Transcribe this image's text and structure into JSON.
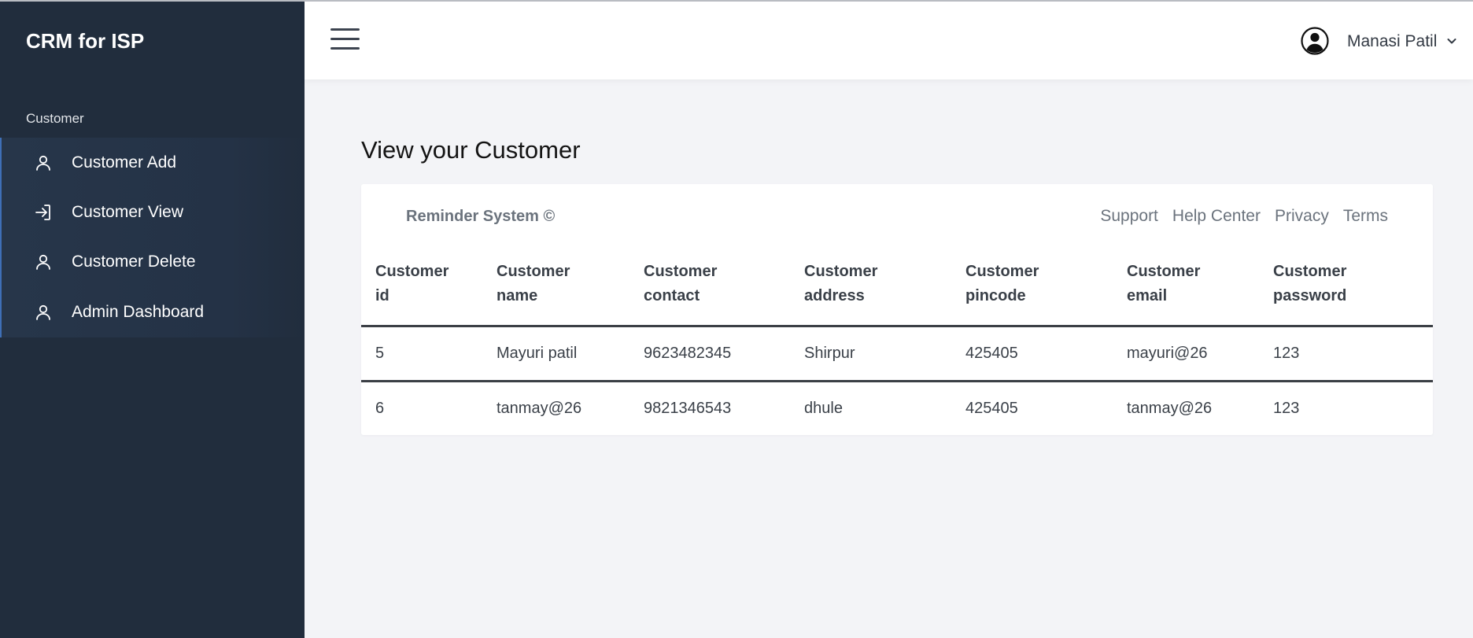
{
  "sidebar": {
    "brand": "CRM for ISP",
    "section_label": "Customer",
    "items": [
      {
        "label": "Customer Add",
        "icon": "user-icon"
      },
      {
        "label": "Customer View",
        "icon": "sign-in-icon"
      },
      {
        "label": "Customer Delete",
        "icon": "user-icon"
      },
      {
        "label": "Admin Dashboard",
        "icon": "user-icon"
      }
    ]
  },
  "header": {
    "menu_icon": "hamburger-icon",
    "user_icon": "user-circle-icon",
    "user_name": "Manasi Patil",
    "caret_icon": "chevron-down-icon"
  },
  "main": {
    "title": "View your Customer",
    "footer_brand": "Reminder System ©",
    "footer_links": [
      "Support",
      "Help Center",
      "Privacy",
      "Terms"
    ],
    "table": {
      "columns": [
        [
          "Customer",
          "id"
        ],
        [
          "Customer",
          "name"
        ],
        [
          "Customer",
          "contact"
        ],
        [
          "Customer",
          "address"
        ],
        [
          "Customer",
          "pincode"
        ],
        [
          "Customer",
          "email"
        ],
        [
          "Customer",
          "password"
        ]
      ],
      "rows": [
        [
          "5",
          "Mayuri patil",
          "9623482345",
          "Shirpur",
          "425405",
          "mayuri@26",
          "123"
        ],
        [
          "6",
          "tanmay@26",
          "9821346543",
          "dhule",
          "425405",
          "tanmay@26",
          "123"
        ]
      ]
    }
  },
  "colors": {
    "sidebar_bg": "#212d3d",
    "active_border": "#3f6fb6",
    "page_bg": "#f3f4f7"
  }
}
